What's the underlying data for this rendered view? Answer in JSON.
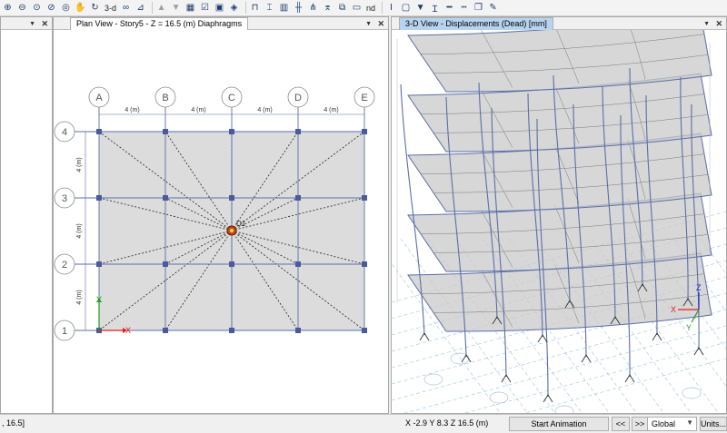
{
  "toolbar": {
    "view_3d_label": "3-d",
    "nd_label": "nd",
    "icons": [
      "zoom-in-icon",
      "zoom-out-icon",
      "zoom-fit-icon",
      "zoom-previous-icon",
      "zoom-window-icon",
      "pan-icon",
      "view-3d-icon",
      "rotate-icon",
      "glasses-icon",
      "move-up-icon",
      "move-down-icon",
      "select-icon",
      "checkbox-icon",
      "set-display-icon",
      "object-shrink-icon",
      "draw-frame-icon",
      "draw-beam-icon",
      "draw-wall-icon",
      "draw-column-icon",
      "draw-link-icon",
      "text-cursor-icon",
      "snap-icon",
      "filter-icon",
      "line-icon",
      "dash-icon",
      "copy-icon",
      "pen-icon"
    ]
  },
  "plan_view": {
    "title": "Plan View - Story5 - Z = 16.5 (m)  Diaphragms",
    "grid_x_labels": [
      "A",
      "B",
      "C",
      "D",
      "E"
    ],
    "grid_y_labels": [
      "4",
      "3",
      "2",
      "1"
    ],
    "x_spacing_label": "4 (m)",
    "y_spacing_label": "4 (m)",
    "diaphragm_label": "D1",
    "axis_x_label": "X",
    "axis_y_label": "Y"
  },
  "view_3d": {
    "title": "3-D View  - Displacements (Dead)  [mm]",
    "axis_x_label": "X",
    "axis_y_label": "Y",
    "axis_z_label": "Z"
  },
  "left_panel": {
    "coord_fragment": ", 16.5]"
  },
  "status": {
    "coords": "X -2.9  Y 8.3  Z 16.5 (m)",
    "start_animation": "Start Animation",
    "prev_label": "<<",
    "next_label": ">>",
    "coord_system": "Global",
    "units_button": "Units..."
  },
  "colors": {
    "grid_line": "#5b6ea8",
    "node": "#4a5a9a",
    "diaphragm_fill": "#dcdcdc",
    "tab_active": "#b8d3ef"
  }
}
